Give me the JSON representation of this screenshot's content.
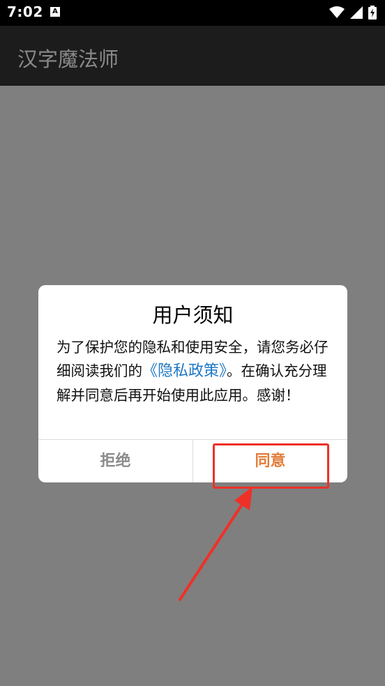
{
  "status_bar": {
    "time": "7:02",
    "notification_glyph": "A",
    "icons": [
      "wifi-icon",
      "signal-icon",
      "battery-charging-icon"
    ]
  },
  "app_bar": {
    "title": "汉字魔法师"
  },
  "dialog": {
    "title": "用户须知",
    "body_before_link": "为了保护您的隐私和使用安全，请您务必仔细阅读我们的",
    "policy_link": "《隐私政策》",
    "body_after_link": "。在确认充分理解并同意后再开始使用此应用。感谢！",
    "reject_label": "拒绝",
    "agree_label": "同意"
  },
  "colors": {
    "agree_accent": "#e27d3a",
    "link": "#1f78c4",
    "annotation_red": "#ee3128"
  }
}
